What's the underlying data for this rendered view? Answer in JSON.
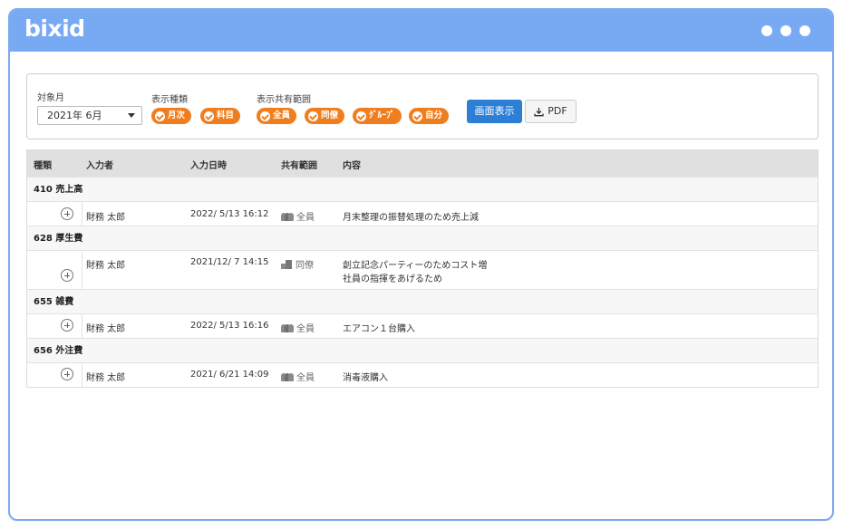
{
  "app": {
    "logo": "bixid"
  },
  "filters": {
    "month_label": "対象月",
    "month_value": "2021年 6月",
    "type_label": "表示種類",
    "type_chips": [
      "月次",
      "科目"
    ],
    "scope_label": "表示共有範囲",
    "scope_chips": [
      "全員",
      "同僚",
      "ｸﾞﾙｰﾌﾟ",
      "自分"
    ],
    "display_button": "画面表示",
    "pdf_button": "PDF"
  },
  "table": {
    "headers": {
      "type": "種類",
      "inputter": "入力者",
      "datetime": "入力日時",
      "scope": "共有範囲",
      "content": "内容"
    },
    "groups": [
      {
        "title": "410 売上高",
        "rows": [
          {
            "inputter": "財務 太郎",
            "datetime": "2022/ 5/13 16:12",
            "scope": "全員",
            "scope_icon": "people-icon",
            "content": [
              "月末整理の振替処理のため売上減"
            ]
          }
        ]
      },
      {
        "title": "628 厚生費",
        "rows": [
          {
            "inputter": "財務 太郎",
            "datetime": "2021/12/ 7 14:15",
            "scope": "同僚",
            "scope_icon": "building-icon",
            "content": [
              "創立記念パーティーのためコスト増",
              "社員の指揮をあげるため"
            ]
          }
        ]
      },
      {
        "title": "655 雑費",
        "rows": [
          {
            "inputter": "財務 太郎",
            "datetime": "2022/ 5/13 16:16",
            "scope": "全員",
            "scope_icon": "people-icon",
            "content": [
              "エアコン１台購入"
            ]
          }
        ]
      },
      {
        "title": "656 外注費",
        "rows": [
          {
            "inputter": "財務 太郎",
            "datetime": "2021/ 6/21 14:09",
            "scope": "全員",
            "scope_icon": "people-icon",
            "content": [
              "消毒液購入"
            ]
          }
        ]
      }
    ]
  },
  "colors": {
    "titlebar": "#78aaf3",
    "chip": "#f07e1f",
    "primary_button": "#2d7fd6"
  }
}
